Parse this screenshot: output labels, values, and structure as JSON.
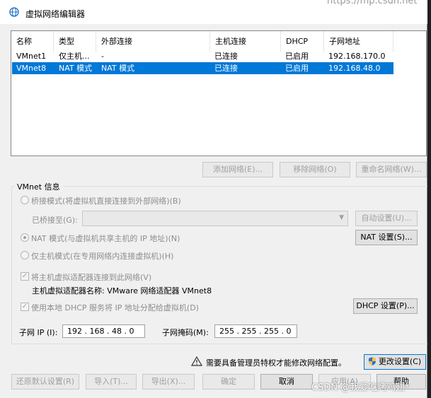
{
  "window": {
    "title": "虚拟网络编辑器",
    "background_url_text": "https://mp.csdn.net"
  },
  "network_table": {
    "columns": [
      "名称",
      "类型",
      "外部连接",
      "主机连接",
      "DHCP",
      "子网地址"
    ],
    "rows": [
      {
        "name": "VMnet1",
        "type": "仅主机...",
        "external": "-",
        "host": "已连接",
        "dhcp": "已启用",
        "subnet": "192.168.170.0",
        "selected": false
      },
      {
        "name": "VMnet8",
        "type": "NAT 模式",
        "external": "NAT 模式",
        "host": "已连接",
        "dhcp": "已启用",
        "subnet": "192.168.48.0",
        "selected": true
      }
    ]
  },
  "table_buttons": {
    "add": "添加网络(E)...",
    "remove": "移除网络(O)",
    "rename": "重命名网络(W)..."
  },
  "vmnet_info": {
    "group_title": "VMnet 信息",
    "bridged_label": "桥接模式(将虚拟机直接连接到外部网络)(B)",
    "bridged_to_label": "已桥接至(G):",
    "auto_settings": "自动设置(U)...",
    "nat_label": "NAT 模式(与虚拟机共享主机的 IP 地址)(N)",
    "nat_settings": "NAT 设置(S)...",
    "hostonly_label": "仅主机模式(在专用网络内连接虚拟机)(H)",
    "connect_adapter_label": "将主机虚拟适配器连接到此网络(V)",
    "adapter_name": "主机虚拟适配器名称: VMware 网络适配器 VMnet8",
    "dhcp_label": "使用本地 DHCP 服务将 IP 地址分配给虚拟机(D)",
    "dhcp_settings": "DHCP 设置(P)...",
    "subnet_ip_label": "子网 IP (I):",
    "subnet_ip_value": "192 . 168 . 48 . 0",
    "subnet_mask_label": "子网掩码(M):",
    "subnet_mask_value": "255 . 255 . 255 . 0"
  },
  "admin_notice": {
    "text": "需要具备管理员特权才能修改网络配置。",
    "change_settings": "更改设置(C)"
  },
  "footer_buttons": {
    "restore_defaults": "还原默认设置(R)",
    "import": "导入(T)...",
    "export": "导出(X)...",
    "ok": "确定",
    "cancel": "取消",
    "apply": "应用(A)",
    "help": "帮助"
  },
  "watermark": "CSDN @我爱吃烤鸡翅*",
  "colors": {
    "selection": "#0078d7",
    "window_bg": "#f0f0f0"
  }
}
